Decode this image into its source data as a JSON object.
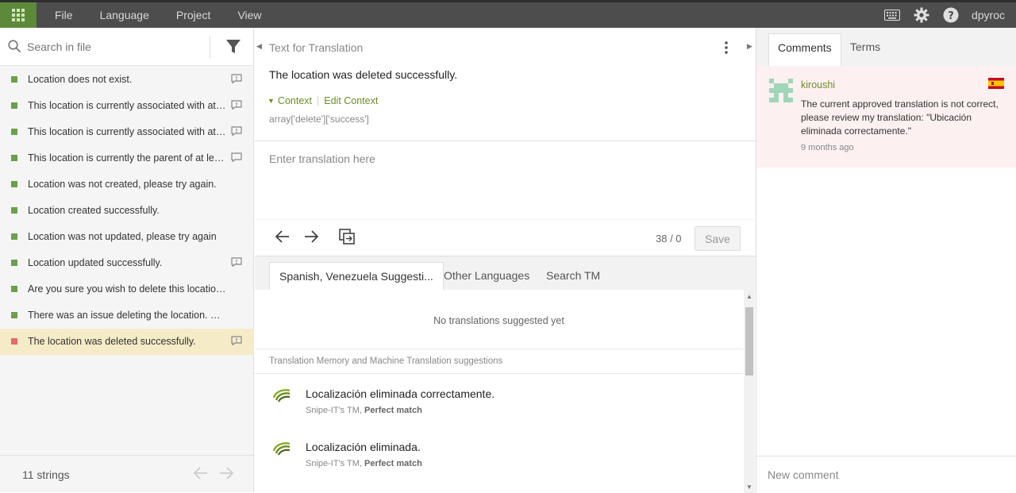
{
  "menu": [
    "File",
    "Language",
    "Project",
    "View"
  ],
  "user": "dpyroc",
  "search": {
    "placeholder": "Search in file"
  },
  "strings": [
    {
      "text": "Location does not exist.",
      "comment": true
    },
    {
      "text": "This location is currently associated with at least one asset and cannot be deleted.",
      "comment": true
    },
    {
      "text": "This location is currently associated with at least one user and cannot be deleted.",
      "comment": true
    },
    {
      "text": "This location is currently the parent of at least one child location and cannot be deleted.",
      "comment": true
    },
    {
      "text": "Location was not created, please try again.",
      "comment": false
    },
    {
      "text": "Location created successfully.",
      "comment": false
    },
    {
      "text": "Location was not updated, please try again",
      "comment": false
    },
    {
      "text": "Location updated successfully.",
      "comment": true
    },
    {
      "text": "Are you sure you wish to delete this location?",
      "comment": false
    },
    {
      "text": "There was an issue deleting the location. Please try again.",
      "comment": false
    },
    {
      "text": "The location was deleted successfully.",
      "comment": true,
      "active": true
    }
  ],
  "strings_count": "11 strings",
  "editor": {
    "source_label": "Text for Translation",
    "source_text": "The location was deleted successfully.",
    "context_label": "Context",
    "edit_context_label": "Edit Context",
    "context_key": "array['delete']['success']",
    "translation_placeholder": "Enter translation here",
    "counter": "38 / 0",
    "save_label": "Save"
  },
  "suggestions": {
    "tabs": [
      "Spanish, Venezuela Suggesti...",
      "Other Languages",
      "Search TM"
    ],
    "empty_text": "No translations suggested yet",
    "tm_header": "Translation Memory and Machine Translation suggestions",
    "items": [
      {
        "text": "Localización eliminada correctamente.",
        "source": "Snipe-IT's TM,",
        "match": "Perfect match"
      },
      {
        "text": "Localización eliminada.",
        "source": "Snipe-IT's TM,",
        "match": "Perfect match"
      }
    ]
  },
  "right_tabs": [
    "Comments",
    "Terms"
  ],
  "comment": {
    "user": "kiroushi",
    "text": "The current approved translation is not correct, please review my translation: \"Ubicación eliminada correctamente.\"",
    "time": "9 months ago"
  },
  "new_comment_placeholder": "New comment",
  "colors": {
    "accent": "#6b8e23",
    "grid_button": "#5d8a3a",
    "topbar": "#4d4d4d",
    "active_row": "#f5ebc7",
    "comment_bg": "#fdf0f0"
  },
  "icons": [
    "apps-grid-icon",
    "keyboard-icon",
    "gear-icon",
    "help-icon",
    "search-icon",
    "filter-icon",
    "comment-icon",
    "kebab-icon",
    "arrow-left-icon",
    "arrow-right-icon",
    "copy-source-icon",
    "tm-logo-icon",
    "avatar-icon",
    "spain-flag-icon"
  ]
}
